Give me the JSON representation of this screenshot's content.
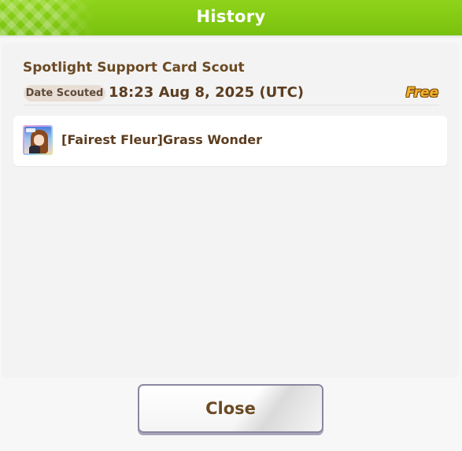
{
  "header": {
    "title": "History"
  },
  "scout": {
    "title": "Spotlight Support Card Scout",
    "date_label": "Date Scouted",
    "date_value": "18:23 Aug 8, 2025 (UTC)",
    "cost_tag": "Free"
  },
  "results": [
    {
      "name": "[Fairest Fleur]Grass Wonder",
      "icon": "support-card-portrait"
    }
  ],
  "footer": {
    "close_label": "Close"
  },
  "colors": {
    "header_green": "#8fd41a",
    "text_brown": "#6b4a24",
    "free_gold": "#f3b32a"
  }
}
